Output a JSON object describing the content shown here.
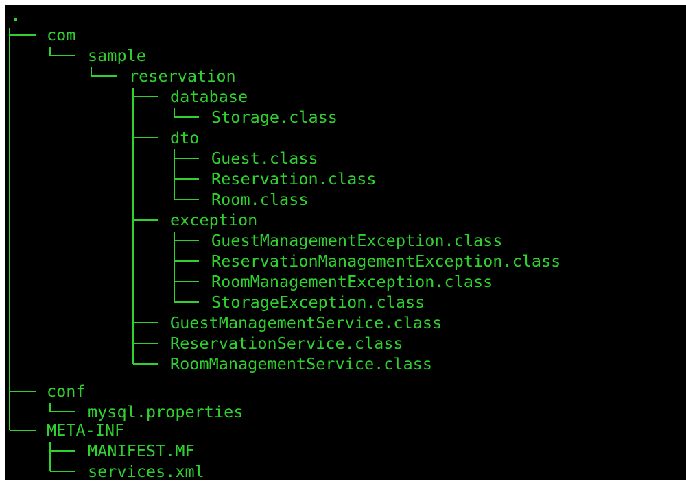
{
  "colors": {
    "terminal_background": "#000000",
    "text": "#2ed12e"
  },
  "tree": {
    "root": ".",
    "com": "com",
    "sample": "sample",
    "reservation": "reservation",
    "database": "database",
    "storage_class": "Storage.class",
    "dto": "dto",
    "guest_class": "Guest.class",
    "reservation_class": "Reservation.class",
    "room_class": "Room.class",
    "exception": "exception",
    "guest_mgmt_exception": "GuestManagementException.class",
    "reservation_mgmt_exception": "ReservationManagementException.class",
    "room_mgmt_exception": "RoomManagementException.class",
    "storage_exception": "StorageException.class",
    "guest_mgmt_service": "GuestManagementService.class",
    "reservation_service": "ReservationService.class",
    "room_mgmt_service": "RoomManagementService.class",
    "conf": "conf",
    "mysql_properties": "mysql.properties",
    "meta_inf": "META-INF",
    "manifest": "MANIFEST.MF",
    "services_xml": "services.xml"
  }
}
